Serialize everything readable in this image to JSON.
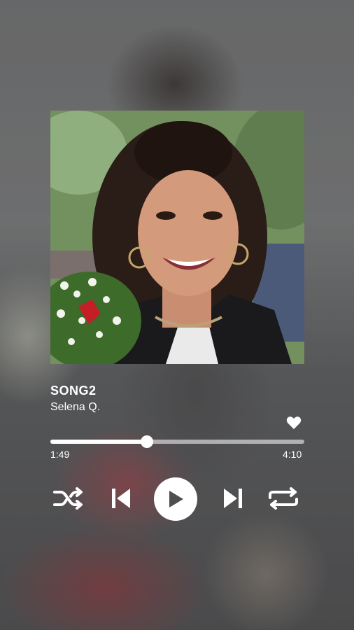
{
  "track": {
    "title": "SONG2",
    "artist": "Selena Q.",
    "liked": true
  },
  "playback": {
    "elapsed": "1:49",
    "total": "4:10",
    "progress_fraction": 0.38,
    "state": "paused"
  },
  "controls": {
    "shuffle_icon": "shuffle-icon",
    "previous_icon": "skip-previous-icon",
    "play_icon": "play-icon",
    "next_icon": "skip-next-icon",
    "repeat_icon": "repeat-icon",
    "like_icon": "heart-icon"
  },
  "colors": {
    "foreground": "#ffffff",
    "play_glyph": "#4f4f50"
  }
}
